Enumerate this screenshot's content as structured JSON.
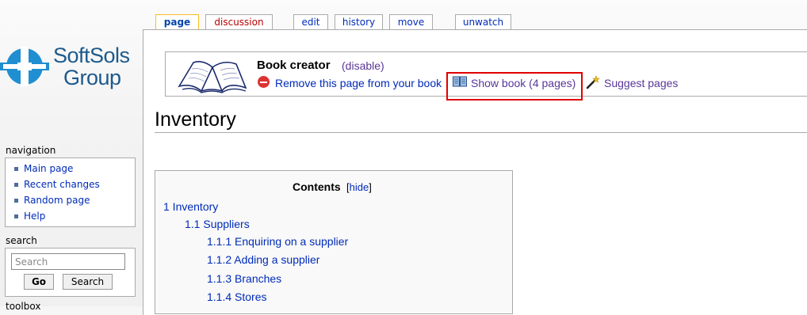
{
  "logo": {
    "line1": "SoftSols",
    "line2": "Group"
  },
  "tabs": {
    "page": "page",
    "discussion": "discussion",
    "edit": "edit",
    "history": "history",
    "move": "move",
    "unwatch": "unwatch"
  },
  "book_creator": {
    "title": "Book creator",
    "disable_open": "(",
    "disable": "disable",
    "disable_close": ")",
    "remove": "Remove this page from your book",
    "show_book": "Show book (4 pages)",
    "suggest": "Suggest pages"
  },
  "page_title": "Inventory",
  "toc": {
    "title": "Contents",
    "hide_open": "[",
    "hide": "hide",
    "hide_close": "]",
    "items": [
      "1 Inventory",
      "1.1 Suppliers",
      "1.1.1 Enquiring on a supplier",
      "1.1.2 Adding a supplier",
      "1.1.3 Branches",
      "1.1.4 Stores"
    ]
  },
  "sidebar": {
    "navigation_title": "navigation",
    "nav_items": [
      "Main page",
      "Recent changes",
      "Random page",
      "Help"
    ],
    "search_title": "search",
    "search_placeholder": "Search",
    "go": "Go",
    "search_button": "Search",
    "toolbox_title": "toolbox"
  },
  "colors": {
    "link": "#002bb8",
    "visited": "#5a3696",
    "highlight": "#e00000",
    "tab_selected": "#fabd23"
  }
}
